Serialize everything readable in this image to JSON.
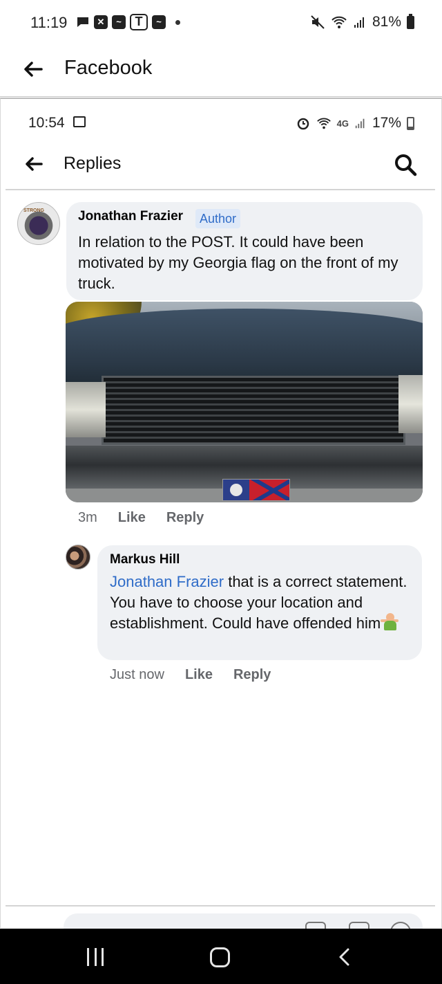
{
  "outer_status": {
    "time": "11:19",
    "notification_icons": [
      "message-icon",
      "chat-icon",
      "app-icon",
      "t-mobile-icon",
      "app-icon"
    ],
    "battery_text": "81%"
  },
  "outer_header": {
    "title": "Facebook"
  },
  "inner_status": {
    "time": "10:54",
    "network_label": "4G",
    "battery_text": "17%"
  },
  "inner_header": {
    "title": "Replies"
  },
  "comments": [
    {
      "author": "Jonathan Frazier",
      "badge": "Author",
      "text": "In relation to the POST. It could have been motivated by my Georgia flag on the front of my truck.",
      "time": "3m",
      "like_label": "Like",
      "reply_label": "Reply"
    },
    {
      "author": "Markus Hill",
      "mention": "Jonathan Frazier",
      "text": " that is a correct statement.  You have to choose your location and establishment.  Could have offended him",
      "emoji": "person-shrugging-emoji",
      "time": "Just now",
      "like_label": "Like",
      "reply_label": "Reply"
    }
  ],
  "colors": {
    "bubble": "#eff1f4",
    "link": "#2f6cc8",
    "muted": "#65676b",
    "badge_bg": "#dfe9f8"
  }
}
